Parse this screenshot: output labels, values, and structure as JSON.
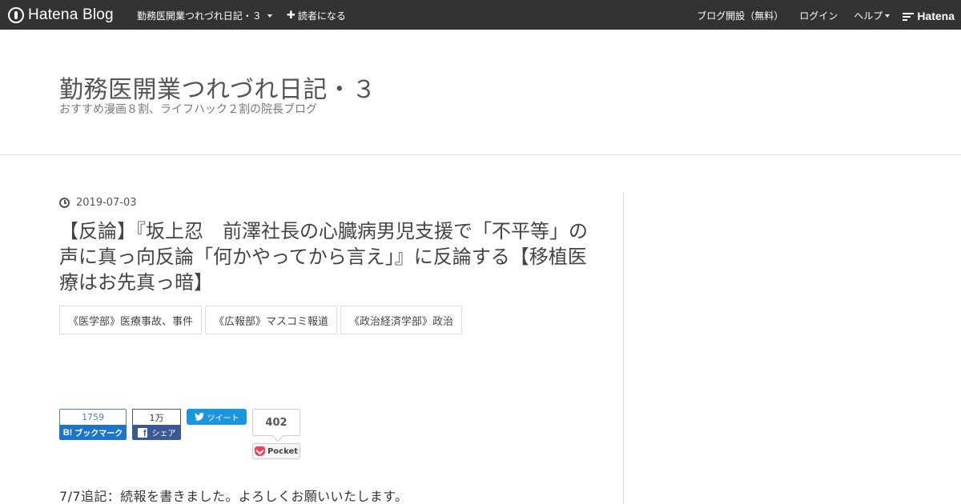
{
  "globalheader": {
    "logo_text": "Hatena Blog",
    "blog_name": "勤務医開業つれづれ日記・３",
    "subscribe_label": "読者になる",
    "open_blog_label": "ブログ開設（無料）",
    "login_label": "ログイン",
    "help_label": "ヘルプ",
    "hatena_label": "Hatena"
  },
  "blog": {
    "title": "勤務医開業つれづれ日記・３",
    "description": "おすすめ漫画８割、ライフハック２割の院長ブログ"
  },
  "entry": {
    "date": "2019-07-03",
    "title": "【反論】『坂上忍　前澤社長の心臓病男児支援で「不平等」の声に真っ向反論「何かやってから言え」』に反論する【移植医療はお先真っ暗】",
    "categories": [
      "《医学部》医療事故、事件",
      "《広報部》マスコミ報道",
      "《政治経済学部》政治"
    ],
    "body_first_line": "7/7追記：続報を書きました。よろしくお願いいたします。"
  },
  "share": {
    "hatena_bookmark_count": "1759",
    "hatena_bookmark_label": "ブックマーク",
    "hatena_bookmark_prefix": "B!",
    "facebook_count": "1万",
    "facebook_label": "シェア",
    "twitter_label": "ツイート",
    "pocket_count": "402",
    "pocket_label": "Pocket"
  },
  "colors": {
    "header_bg": "#333333",
    "hatena_blue": "#1d75c9",
    "facebook_blue": "#3b5998",
    "twitter_blue": "#1b95e0",
    "pocket_red": "#ef4056"
  }
}
